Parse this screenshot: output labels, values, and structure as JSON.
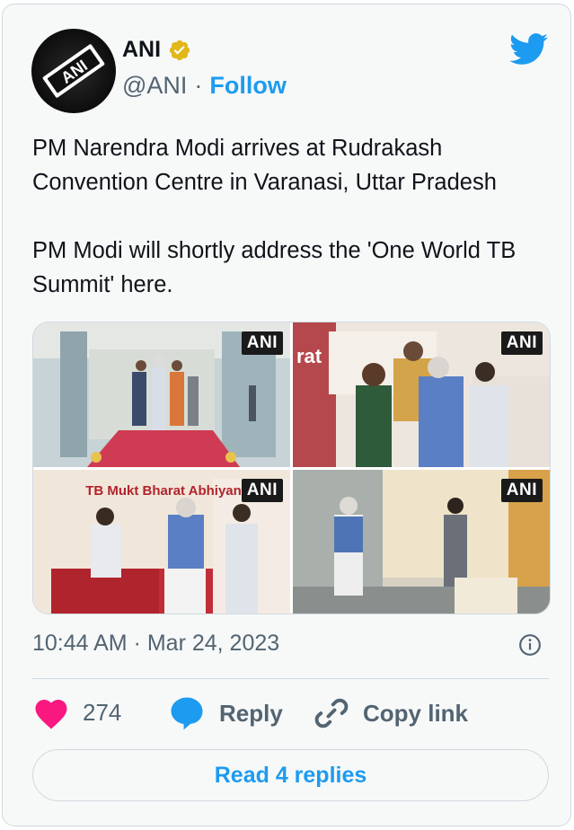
{
  "author": {
    "name": "ANI",
    "handle": "@ANI",
    "separator": "·",
    "follow_label": "Follow",
    "avatar_text": "ANI",
    "verified": true
  },
  "tweet": {
    "line1": "PM Narendra Modi arrives at Rudrakash Convention Centre in Varanasi, Uttar Pradesh",
    "line2": "PM Modi will shortly address the 'One World TB Summit' here."
  },
  "media": {
    "photos": [
      {
        "badge": "ANI",
        "sign_text": ""
      },
      {
        "badge": "ANI",
        "sign_text": "rat"
      },
      {
        "badge": "ANI",
        "sign_text": "TB Mukt Bharat Abhiyan"
      },
      {
        "badge": "ANI",
        "sign_text": ""
      }
    ]
  },
  "meta": {
    "timestamp": "10:44 AM · Mar 24, 2023"
  },
  "actions": {
    "like_count": "274",
    "reply_label": "Reply",
    "copy_label": "Copy link"
  },
  "read_replies_label": "Read 4 replies",
  "colors": {
    "accent": "#1d9bf0",
    "like": "#f91880",
    "verified": "#e2b719",
    "secondary_text": "#536471"
  }
}
